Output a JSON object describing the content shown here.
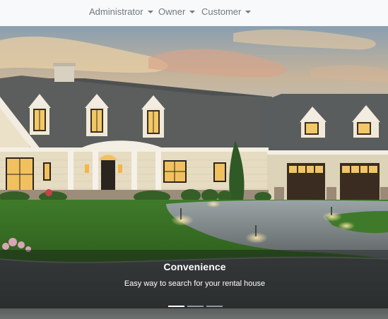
{
  "nav": {
    "items": [
      {
        "label": "Administrator",
        "has_dropdown": true
      },
      {
        "label": "Owner",
        "has_dropdown": true
      },
      {
        "label": "Customer",
        "has_dropdown": true
      }
    ]
  },
  "carousel": {
    "active_slide": 1,
    "slide_count": 3,
    "caption": {
      "title": "Convenience",
      "text": "Easy way to search for your rental house"
    },
    "image_subject": "suburban-house-at-dusk"
  },
  "colors": {
    "navbar_bg": "#f8f9fa",
    "nav_text": "#707a82",
    "caption_text": "#ffffff"
  }
}
